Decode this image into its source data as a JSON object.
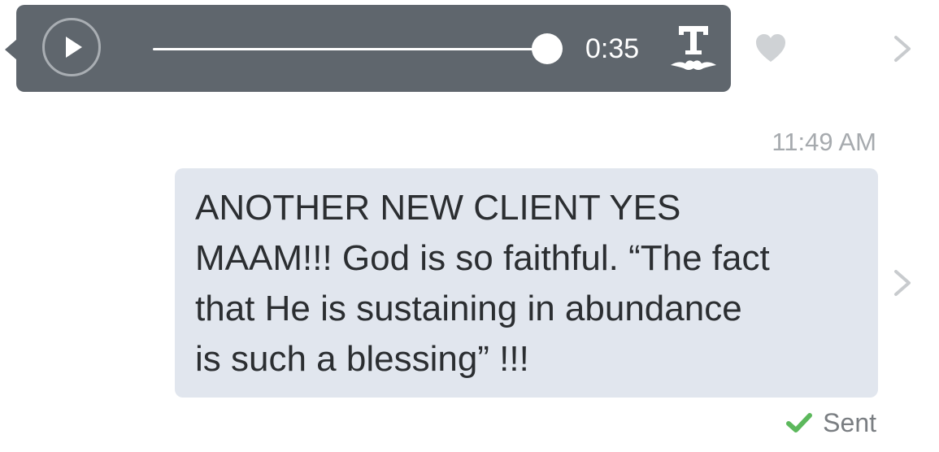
{
  "audio_message": {
    "duration": "0:35",
    "progress": 1.0,
    "play_icon": "play-icon",
    "transcribe_icon": "transcribe-icon",
    "like_icon": "heart-icon",
    "details_icon": "chevron-right-icon"
  },
  "text_message": {
    "timestamp": "11:49 AM",
    "body": "ANOTHER NEW CLIENT YES\nMAAM!!! God is so faithful. “The fact\nthat He is sustaining in abundance\nis such a blessing” !!!",
    "details_icon": "chevron-right-icon",
    "status": "Sent",
    "status_icon": "checkmark-icon"
  },
  "colors": {
    "audio_bubble": "#5f666d",
    "text_bubble": "#e1e6ee",
    "sent_check": "#5cb85c",
    "muted_text": "#a6aaae"
  }
}
